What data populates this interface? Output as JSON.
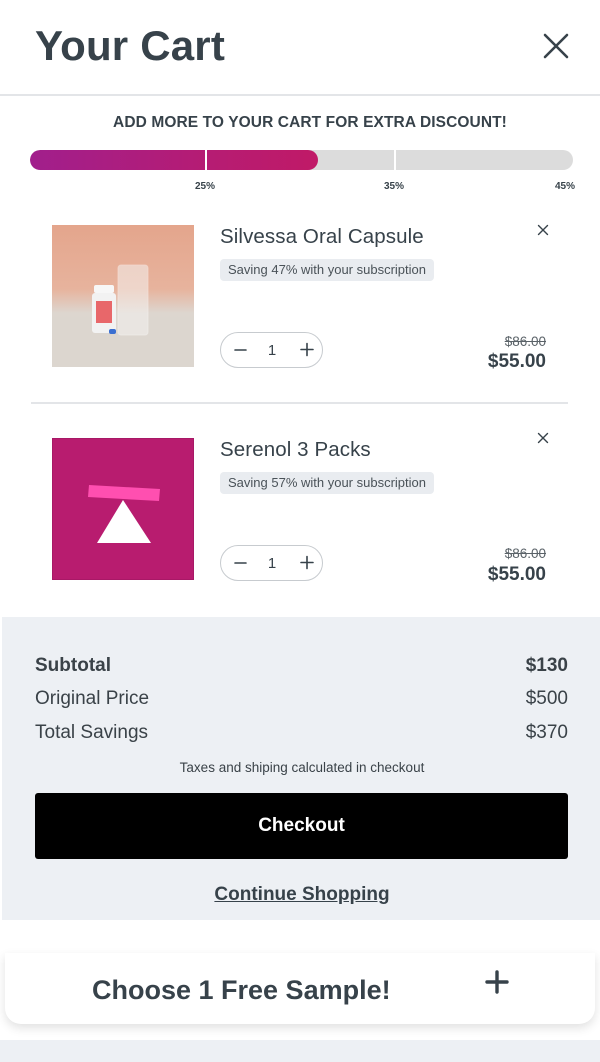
{
  "header": {
    "title": "Your Cart",
    "close_icon": "close-icon"
  },
  "progress": {
    "title": "ADD MORE TO YOUR CART FOR EXTRA DISCOUNT!",
    "fill_fraction": 0.53,
    "milestones": [
      {
        "label": "25%",
        "fraction": 0.325
      },
      {
        "label": "35%",
        "fraction": 0.672
      },
      {
        "label": "45%",
        "fraction": 1.0
      }
    ],
    "fill_color": "#b51c74"
  },
  "items": [
    {
      "name": "Silvessa Oral Capsule",
      "saving": "Saving 47% with your subscription",
      "quantity": "1",
      "old_price": "$86.00",
      "price": "$55.00",
      "image_icon": "product-photo-icon"
    },
    {
      "name": "Serenol 3 Packs",
      "saving": "Saving 57% with your subscription",
      "quantity": "1",
      "old_price": "$86.00",
      "price": "$55.00",
      "image_icon": "brand-logo-icon"
    }
  ],
  "summary": {
    "subtotal_label": "Subtotal",
    "subtotal_value": "$130",
    "original_label": "Original Price",
    "original_value": "$500",
    "savings_label": "Total Savings",
    "savings_value": "$370",
    "tax_note": "Taxes and shiping calculated in checkout",
    "checkout_label": "Checkout",
    "continue_label": "Continue Shopping"
  },
  "sample": {
    "label": "Choose 1 Free Sample!",
    "icon": "plus-icon"
  },
  "colors": {
    "accent": "#b81c6f",
    "text": "#37424a",
    "summary_bg": "#edf0f4"
  }
}
